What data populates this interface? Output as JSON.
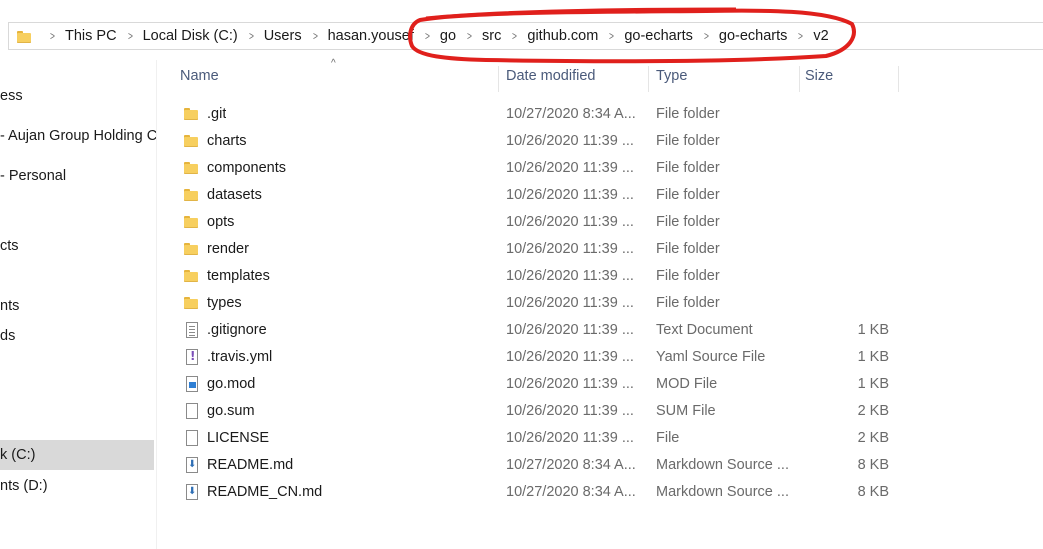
{
  "breadcrumbs": [
    "This PC",
    "Local Disk (C:)",
    "Users",
    "hasan.yousef",
    "go",
    "src",
    "github.com",
    "go-echarts",
    "go-echarts",
    "v2"
  ],
  "nav": {
    "items": [
      {
        "label": "ess",
        "top": 0
      },
      {
        "label": "- Aujan Group Holding C",
        "top": 0
      },
      {
        "label": "- Personal",
        "top": 0
      },
      {
        "label": "cts",
        "top": 0
      },
      {
        "label": "nts",
        "top": 0
      },
      {
        "label": "ds",
        "top": 0
      },
      {
        "label": "k (C:)",
        "top": 0
      },
      {
        "label": "nts (D:)",
        "top": 0
      }
    ]
  },
  "columns": {
    "name": "Name",
    "date": "Date modified",
    "type": "Type",
    "size": "Size"
  },
  "files": [
    {
      "name": ".git",
      "date": "10/27/2020 8:34 A...",
      "type": "File folder",
      "size": "",
      "icon": "folder-icon"
    },
    {
      "name": "charts",
      "date": "10/26/2020 11:39 ...",
      "type": "File folder",
      "size": "",
      "icon": "folder-icon"
    },
    {
      "name": "components",
      "date": "10/26/2020 11:39 ...",
      "type": "File folder",
      "size": "",
      "icon": "folder-icon"
    },
    {
      "name": "datasets",
      "date": "10/26/2020 11:39 ...",
      "type": "File folder",
      "size": "",
      "icon": "folder-icon"
    },
    {
      "name": "opts",
      "date": "10/26/2020 11:39 ...",
      "type": "File folder",
      "size": "",
      "icon": "folder-icon"
    },
    {
      "name": "render",
      "date": "10/26/2020 11:39 ...",
      "type": "File folder",
      "size": "",
      "icon": "folder-icon"
    },
    {
      "name": "templates",
      "date": "10/26/2020 11:39 ...",
      "type": "File folder",
      "size": "",
      "icon": "folder-icon"
    },
    {
      "name": "types",
      "date": "10/26/2020 11:39 ...",
      "type": "File folder",
      "size": "",
      "icon": "folder-icon"
    },
    {
      "name": ".gitignore",
      "date": "10/26/2020 11:39 ...",
      "type": "Text Document",
      "size": "1 KB",
      "icon": "text-document-icon"
    },
    {
      "name": ".travis.yml",
      "date": "10/26/2020 11:39 ...",
      "type": "Yaml Source File",
      "size": "1 KB",
      "icon": "yaml-file-icon"
    },
    {
      "name": "go.mod",
      "date": "10/26/2020 11:39 ...",
      "type": "MOD File",
      "size": "1 KB",
      "icon": "mod-file-icon"
    },
    {
      "name": "go.sum",
      "date": "10/26/2020 11:39 ...",
      "type": "SUM File",
      "size": "2 KB",
      "icon": "file-icon"
    },
    {
      "name": "LICENSE",
      "date": "10/26/2020 11:39 ...",
      "type": "File",
      "size": "2 KB",
      "icon": "file-icon"
    },
    {
      "name": "README.md",
      "date": "10/27/2020 8:34 A...",
      "type": "Markdown Source ...",
      "size": "8 KB",
      "icon": "markdown-file-icon"
    },
    {
      "name": "README_CN.md",
      "date": "10/27/2020 8:34 A...",
      "type": "Markdown Source ...",
      "size": "8 KB",
      "icon": "markdown-file-icon"
    }
  ],
  "colors": {
    "annotation": "#e0201c",
    "selection": "#d9d9d9",
    "header_text": "#4a5a7a"
  }
}
